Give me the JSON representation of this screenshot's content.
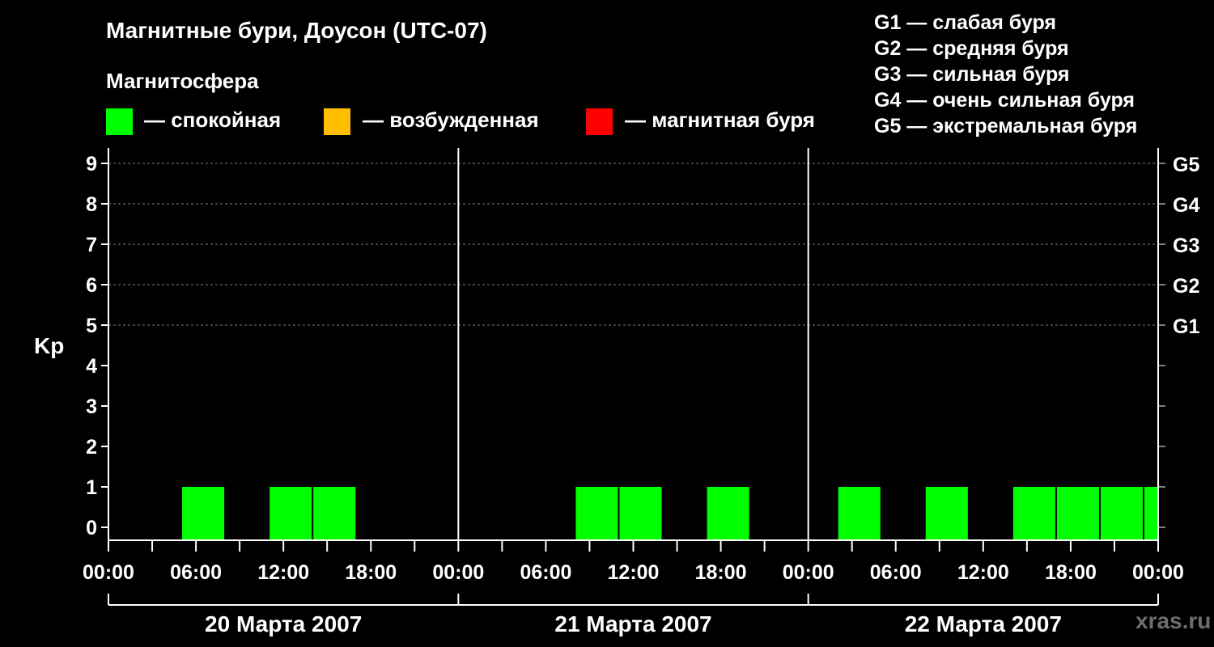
{
  "chart_data": {
    "type": "bar",
    "title": "Магнитные бури, Доусон (UTC-07)",
    "subtitle": "Магнитосфера",
    "ylabel": "Kp",
    "ylim": [
      0,
      9
    ],
    "y_ticks": [
      "0",
      "1",
      "2",
      "3",
      "4",
      "5",
      "6",
      "7",
      "8",
      "9"
    ],
    "right_ticks": [
      {
        "kp": 5,
        "label": "G1"
      },
      {
        "kp": 6,
        "label": "G2"
      },
      {
        "kp": 7,
        "label": "G3"
      },
      {
        "kp": 8,
        "label": "G4"
      },
      {
        "kp": 9,
        "label": "G5"
      }
    ],
    "x_tick_labels": [
      "00:00",
      "06:00",
      "12:00",
      "18:00",
      "00:00",
      "06:00",
      "12:00",
      "18:00",
      "00:00",
      "06:00",
      "12:00",
      "18:00",
      "00:00"
    ],
    "days": [
      "20 Марта 2007",
      "21 Марта 2007",
      "22 Марта 2007"
    ],
    "bar_hours": 3,
    "grid": "dashed horizontal at Kp 5-9",
    "legend": [
      {
        "label": "— спокойная",
        "color": "#00ff00"
      },
      {
        "label": "— возбужденная",
        "color": "#ffbf00"
      },
      {
        "label": "— магнитная буря",
        "color": "#ff0000"
      }
    ],
    "g_legend": [
      "G1 — слабая буря",
      "G2 — средняя буря",
      "G3 — сильная буря",
      "G4 — очень сильная буря",
      "G5 — экстремальная буря"
    ],
    "series": [
      {
        "values": [
          {
            "day": 0,
            "start_hour": 5,
            "kp": 1
          },
          {
            "day": 0,
            "start_hour": 11,
            "kp": 1
          },
          {
            "day": 0,
            "start_hour": 14,
            "kp": 1
          },
          {
            "day": 1,
            "start_hour": 8,
            "kp": 1
          },
          {
            "day": 1,
            "start_hour": 11,
            "kp": 1
          },
          {
            "day": 1,
            "start_hour": 17,
            "kp": 1
          },
          {
            "day": 2,
            "start_hour": 2,
            "kp": 1
          },
          {
            "day": 2,
            "start_hour": 8,
            "kp": 1
          },
          {
            "day": 2,
            "start_hour": 14,
            "kp": 1
          },
          {
            "day": 2,
            "start_hour": 17,
            "kp": 1
          },
          {
            "day": 2,
            "start_hour": 20,
            "kp": 1
          },
          {
            "day": 2,
            "start_hour": 23,
            "kp": 1,
            "hours": 1
          }
        ]
      }
    ],
    "bar_color": "#00ff00"
  },
  "source": "xras.ru"
}
